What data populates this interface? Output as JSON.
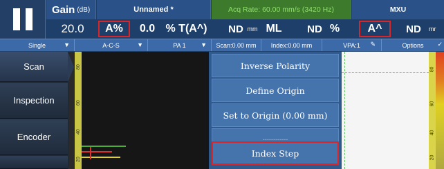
{
  "header": {
    "gain_label": "Gain",
    "gain_unit": "(dB)",
    "gain_value": "20.0",
    "file_name": "Unnamed *",
    "acq_rate": "Acq Rate: 60.00 mm/s (3420 Hz)",
    "unit_name": "MXU",
    "readings": [
      "A%",
      "0.0",
      "%",
      "T(A^)",
      "ND",
      "mm",
      "ML",
      "ND",
      "%",
      "A^",
      "ND",
      "mr"
    ]
  },
  "toolbar": {
    "single": "Single",
    "view": "A-C-S",
    "probe": "PA 1",
    "scan": "Scan:0.00 mm",
    "index": "Index:0.00 mm",
    "vpa": "VPA:1",
    "options": "Options"
  },
  "sidebar": {
    "items": [
      "Scan",
      "Inspection",
      "Encoder"
    ]
  },
  "ruler_left": [
    "80",
    "60",
    "40",
    "20"
  ],
  "ruler_right": [
    "80",
    "60",
    "40",
    "20"
  ],
  "menu": {
    "items": [
      "Inverse Polarity",
      "Define Origin",
      "Set to Origin (0.00 mm)",
      "------------",
      "Index Step"
    ]
  },
  "colors": {
    "header_bg": "#1e3f6a",
    "acq_text": "#8fe06e",
    "menu_item": "#4574ad",
    "highlight": "#d8262a"
  }
}
